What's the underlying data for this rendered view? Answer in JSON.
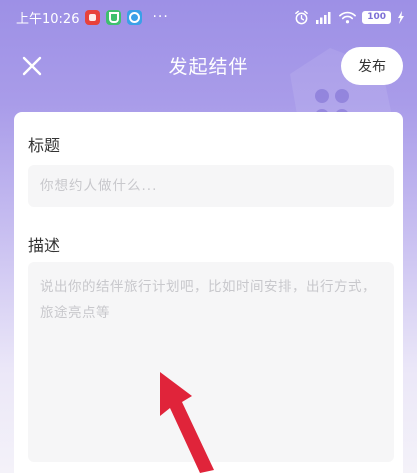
{
  "status_bar": {
    "time": "上午10:26",
    "dots": "···",
    "battery": "100"
  },
  "header": {
    "title": "发起结伴",
    "publish_label": "发布"
  },
  "form": {
    "title_label": "标题",
    "title_placeholder": "你想约人做什么...",
    "description_label": "描述",
    "description_placeholder": "说出你的结伴旅行计划吧，比如时间安排，出行方式，旅途亮点等"
  },
  "colors": {
    "header_gradient_top": "#9d90e6",
    "arrow": "#e0243a",
    "input_bg": "#f6f6f7"
  }
}
